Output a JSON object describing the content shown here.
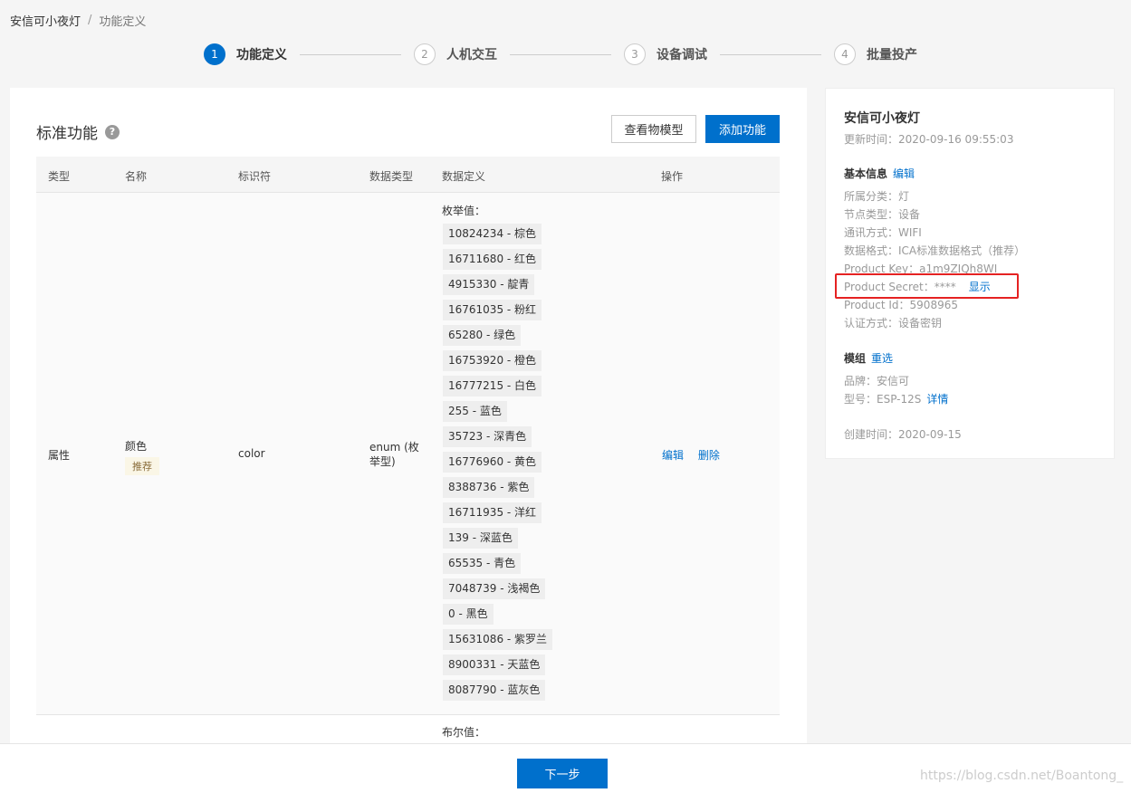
{
  "breadcrumb": {
    "product": "安信可小夜灯",
    "separator": "/",
    "current": "功能定义"
  },
  "steps": [
    {
      "num": "1",
      "label": "功能定义"
    },
    {
      "num": "2",
      "label": "人机交互"
    },
    {
      "num": "3",
      "label": "设备调试"
    },
    {
      "num": "4",
      "label": "批量投产"
    }
  ],
  "main": {
    "title": "标准功能",
    "help_glyph": "?",
    "view_model_label": "查看物模型",
    "add_function_label": "添加功能"
  },
  "table": {
    "headers": [
      "类型",
      "名称",
      "标识符",
      "数据类型",
      "数据定义",
      "操作"
    ],
    "row1": {
      "type": "属性",
      "name": "颜色",
      "tag": "推荐",
      "identifier": "color",
      "data_type": "enum (枚举型)",
      "enum_title": "枚举值：",
      "enum_values": [
        "10824234 - 棕色",
        "16711680 - 红色",
        "4915330 - 靛青",
        "16761035 - 粉红",
        "65280 - 绿色",
        "16753920 - 橙色",
        "16777215 - 白色",
        "255 - 蓝色",
        "35723 - 深青色",
        "16776960 - 黄色",
        "8388736 - 紫色",
        "16711935 - 洋红",
        "139 - 深蓝色",
        "65535 - 青色",
        "7048739 - 浅褐色",
        "0 - 黑色",
        "15631086 - 紫罗兰",
        "8900331 - 天蓝色",
        "8087790 - 蓝灰色"
      ],
      "edit_label": "编辑",
      "delete_label": "删除"
    },
    "row2": {
      "def_title": "布尔值："
    }
  },
  "side": {
    "title": "安信可小夜灯",
    "update_time": "更新时间：2020-09-16 09:55:03",
    "basic_info_label": "基本信息",
    "basic_edit": "编辑",
    "category": "所属分类：灯",
    "node_type": "节点类型：设备",
    "comm": "通讯方式：WIFI",
    "data_format": "数据格式：ICA标准数据格式（推荐）",
    "product_key": "Product Key：a1m9ZIQh8WI",
    "product_secret": "Product Secret：****",
    "show_label": "显示",
    "product_id": "Product Id：5908965",
    "auth": "认证方式：设备密钥",
    "module_label": "模组",
    "module_reselect": "重选",
    "brand": "品牌：安信可",
    "model": "型号：ESP-12S",
    "detail_label": "详情",
    "created": "创建时间：2020-09-15"
  },
  "footer": {
    "next_label": "下一步",
    "watermark": "https://blog.csdn.net/Boantong_"
  },
  "colors": {
    "primary": "#0070cc",
    "highlight": "#e52222"
  }
}
